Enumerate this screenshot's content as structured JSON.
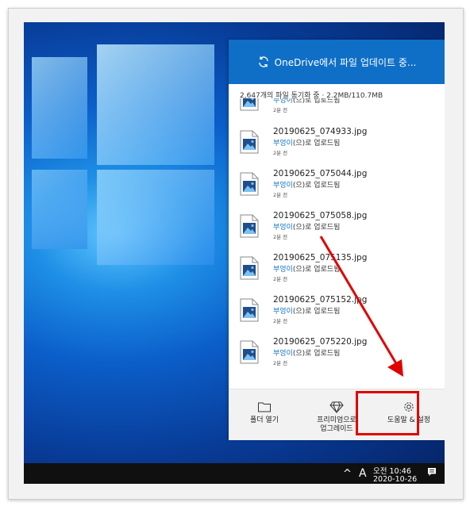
{
  "onedrive": {
    "title": "OneDrive에서 파일 업데이트 중...",
    "status": "2,647개의 파일 동기화 중 · 2.2MB/110.7MB",
    "files": [
      {
        "name": "",
        "user": "부엉이",
        "action": "(으)로 업로드됨",
        "time": "2분 전"
      },
      {
        "name": "20190625_074933.jpg",
        "user": "부엉이",
        "action": "(으)로 업로드됨",
        "time": "2분 전"
      },
      {
        "name": "20190625_075044.jpg",
        "user": "부엉이",
        "action": "(으)로 업로드됨",
        "time": "2분 전"
      },
      {
        "name": "20190625_075058.jpg",
        "user": "부엉이",
        "action": "(으)로 업로드됨",
        "time": "2분 전"
      },
      {
        "name": "20190625_075135.jpg",
        "user": "부엉이",
        "action": "(으)로 업로드됨",
        "time": "2분 전"
      },
      {
        "name": "20190625_075152.jpg",
        "user": "부엉이",
        "action": "(으)로 업로드됨",
        "time": "2분 전"
      },
      {
        "name": "20190625_075220.jpg",
        "user": "부엉이",
        "action": "(으)로 업로드됨",
        "time": "2분 전"
      }
    ],
    "footer": {
      "open_folder": "폴더 열기",
      "premium_line1": "프리미엄으로",
      "premium_line2": "업그레이드",
      "help_settings": "도움말 & 설정"
    }
  },
  "taskbar": {
    "chevron": "^",
    "ime": "A",
    "time": "오전 10:46",
    "date": "2020-10-26"
  },
  "colors": {
    "accent": "#0f6fc6",
    "highlight": "#e00000",
    "taskbar": "#101010"
  },
  "icons": [
    "sync-icon",
    "image-file-icon",
    "folder-icon",
    "diamond-icon",
    "gear-icon",
    "notification-icon"
  ]
}
